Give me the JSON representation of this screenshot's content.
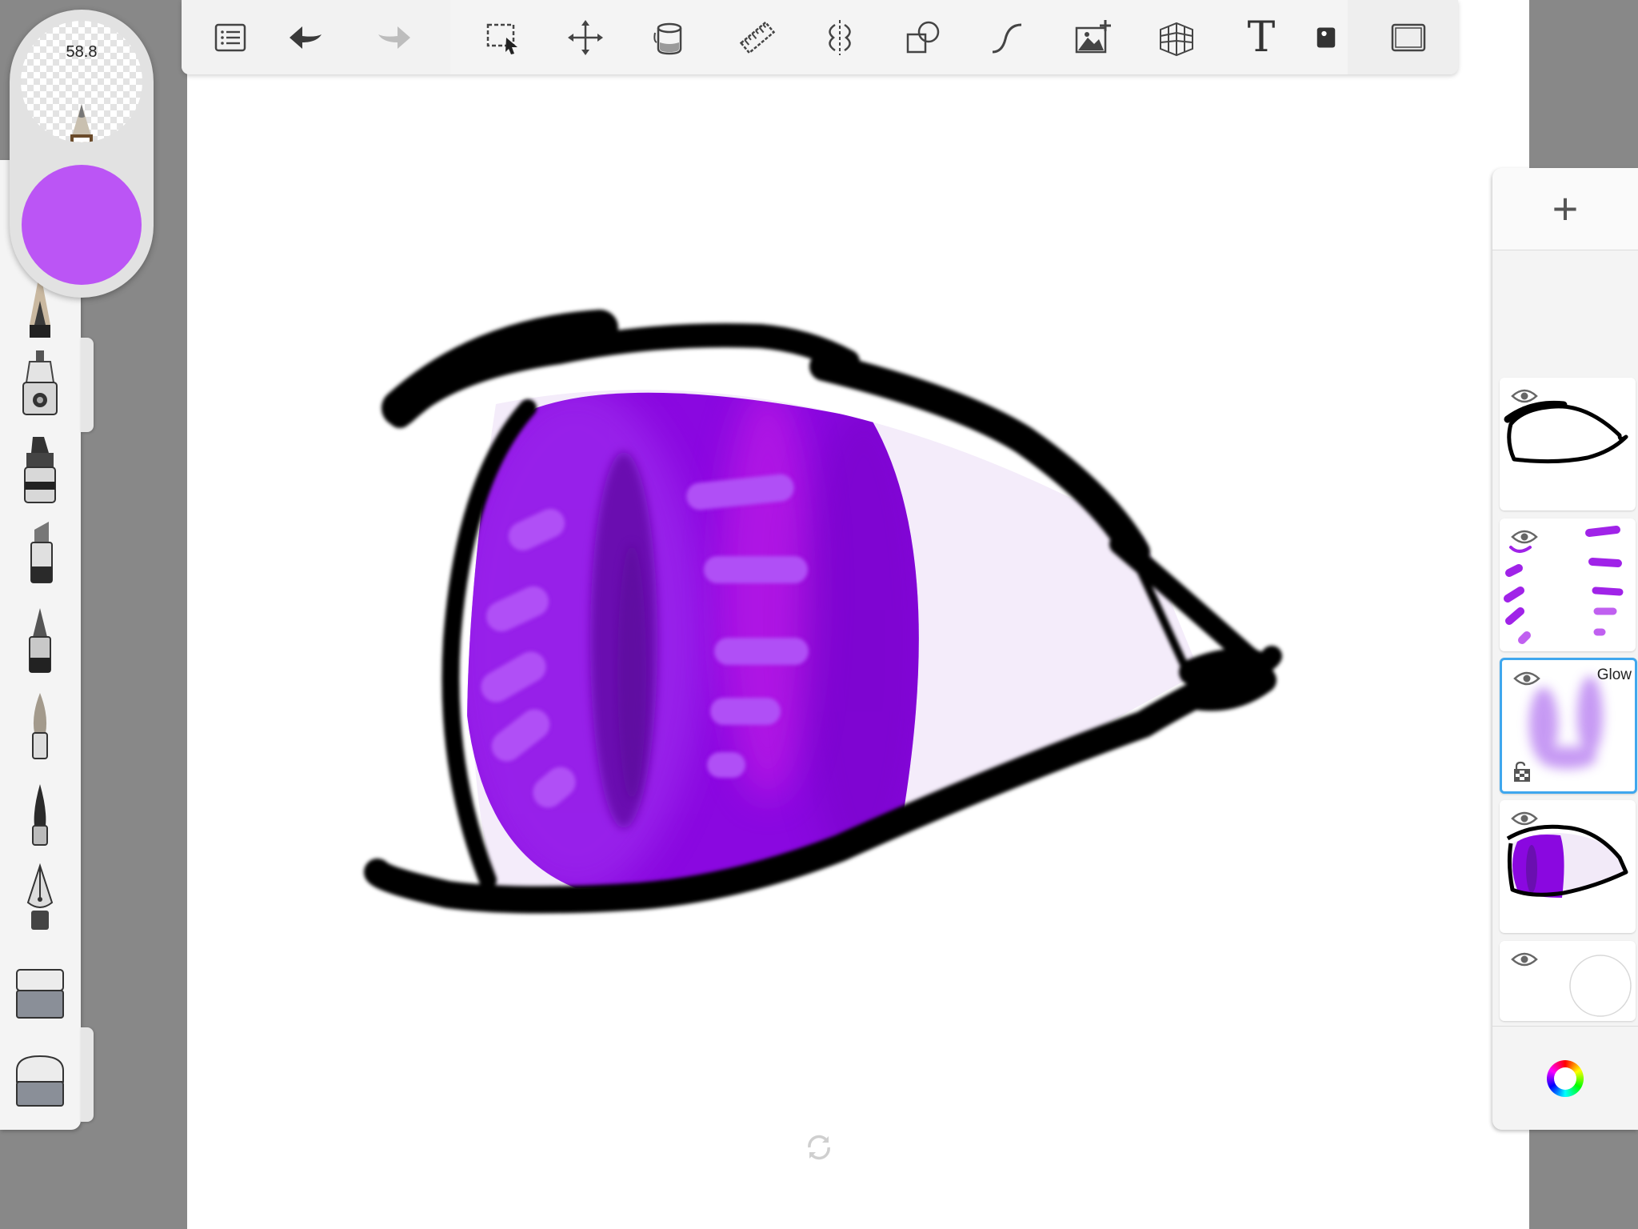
{
  "brush": {
    "size": "58.8",
    "color": "#bb55f5"
  },
  "toolbar": {
    "items": [
      {
        "name": "gallery-icon"
      },
      {
        "name": "undo-icon"
      },
      {
        "name": "redo-icon"
      },
      {
        "name": "selection-icon"
      },
      {
        "name": "transform-icon"
      },
      {
        "name": "fill-icon"
      },
      {
        "name": "ruler-icon"
      },
      {
        "name": "symmetry-icon"
      },
      {
        "name": "shapes-icon"
      },
      {
        "name": "curve-icon"
      },
      {
        "name": "add-image-icon"
      },
      {
        "name": "perspective-icon"
      },
      {
        "name": "text-icon"
      },
      {
        "name": "scene-icon"
      },
      {
        "name": "fullscreen-icon"
      }
    ],
    "text_tool_label": "T"
  },
  "brushes": [
    "pencil-icon",
    "airbrush-icon",
    "marker-icon",
    "chisel-marker-icon",
    "fineliner-icon",
    "paintbrush-icon",
    "ink-pen-icon",
    "fountain-pen-icon",
    "hard-eraser-icon",
    "soft-eraser-icon"
  ],
  "layers": {
    "add_label": "+",
    "items": [
      {
        "name": "layer-outline",
        "label": ""
      },
      {
        "name": "layer-highlights",
        "label": ""
      },
      {
        "name": "layer-glow",
        "label": "Glow",
        "selected": true
      },
      {
        "name": "layer-iris",
        "label": ""
      },
      {
        "name": "layer-background",
        "label": ""
      }
    ]
  },
  "colors": {
    "accent": "#3fa7ee",
    "iris": "#8a08e0",
    "outline": "#000000"
  }
}
